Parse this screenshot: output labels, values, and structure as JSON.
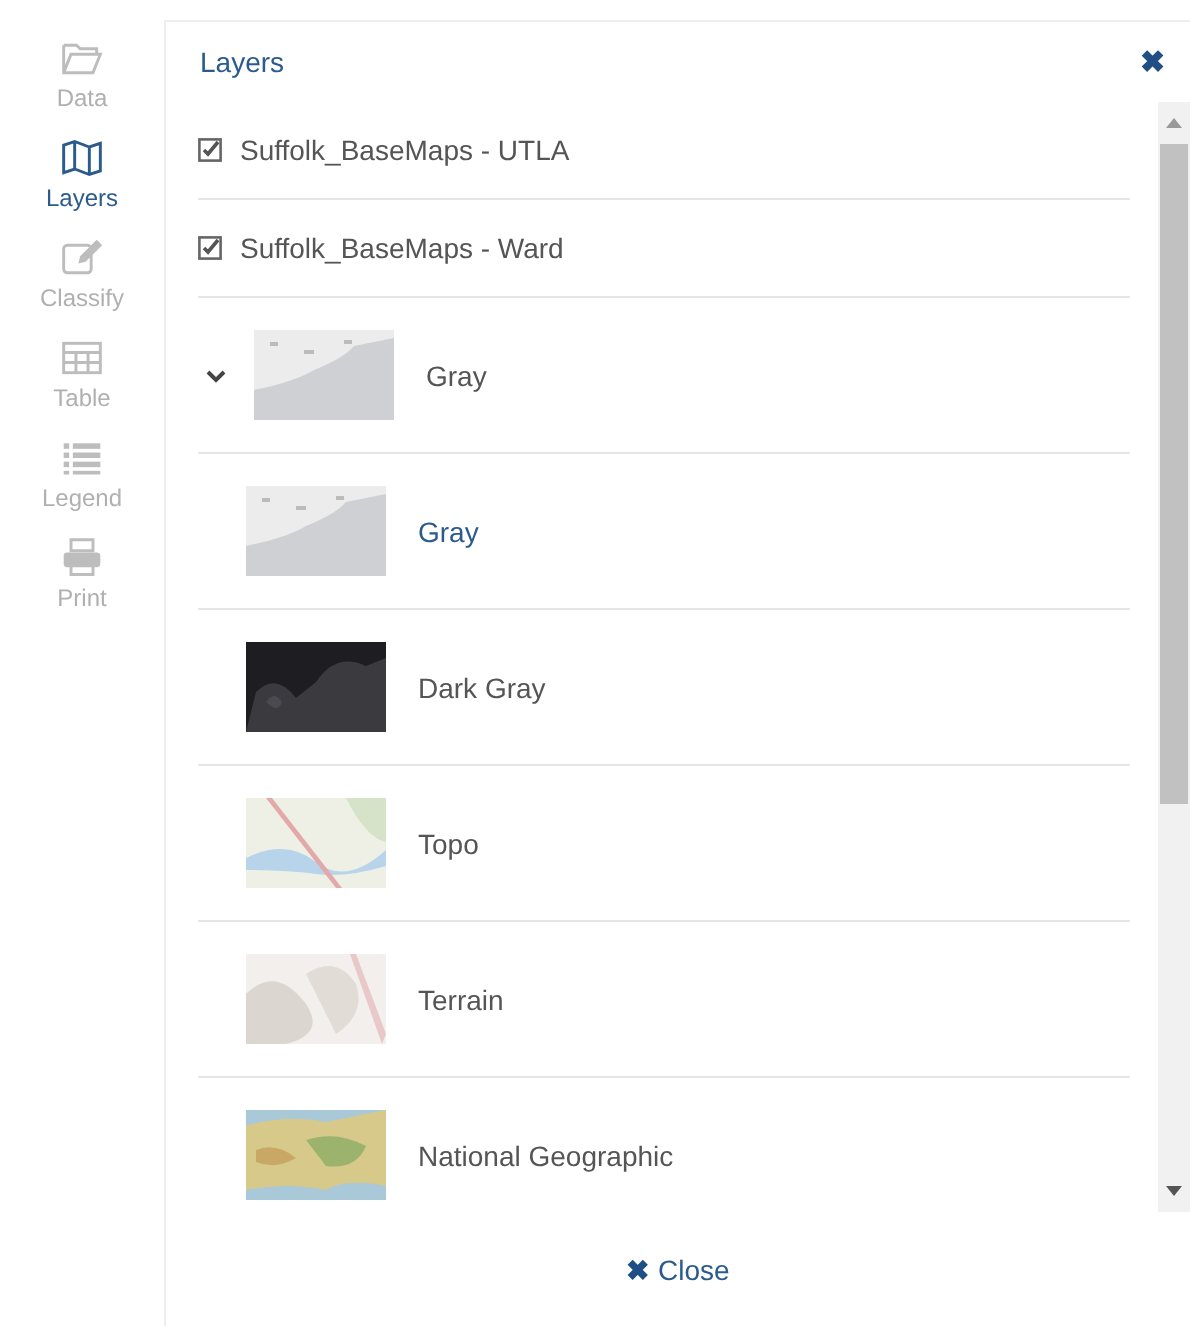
{
  "sidebar": {
    "items": [
      {
        "label": "Data",
        "kind": "folder",
        "selected": false
      },
      {
        "label": "Layers",
        "kind": "map",
        "selected": true
      },
      {
        "label": "Classify",
        "kind": "edit",
        "selected": false
      },
      {
        "label": "Table",
        "kind": "table",
        "selected": false
      },
      {
        "label": "Legend",
        "kind": "list",
        "selected": false
      },
      {
        "label": "Print",
        "kind": "print",
        "selected": false
      }
    ]
  },
  "panel": {
    "title": "Layers",
    "close_icon": "✖",
    "layers": [
      {
        "label": "Suffolk_BaseMaps - UTLA",
        "checked": true
      },
      {
        "label": "Suffolk_BaseMaps - Ward",
        "checked": true
      }
    ],
    "basemap": {
      "label": "Gray",
      "kind": "gray",
      "expanded": true,
      "children": [
        {
          "label": "Gray",
          "kind": "gray",
          "selected": true
        },
        {
          "label": "Dark Gray",
          "kind": "dark",
          "selected": false
        },
        {
          "label": "Topo",
          "kind": "topo",
          "selected": false
        },
        {
          "label": "Terrain",
          "kind": "terrain",
          "selected": false
        },
        {
          "label": "National Geographic",
          "kind": "natgeo",
          "selected": false
        }
      ]
    },
    "footer": {
      "icon": "✖",
      "label": "Close"
    }
  }
}
